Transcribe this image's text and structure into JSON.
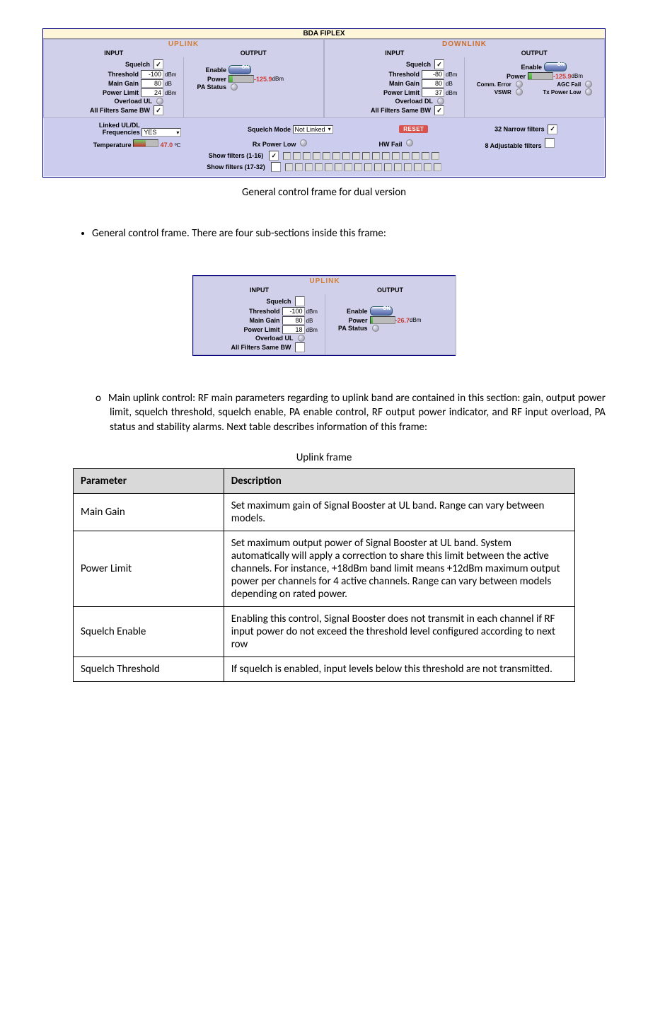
{
  "figTitle": "BDA FIPLEX",
  "uplink": {
    "title": "UPLINK",
    "input": "INPUT",
    "output": "OUTPUT",
    "in": {
      "squelch_l": "Squelch",
      "squelch_chk": "✓",
      "threshold_l": "Threshold",
      "threshold_v": "-100",
      "threshold_u": "dBm",
      "gain_l": "Main Gain",
      "gain_v": "80",
      "gain_u": "dB",
      "plimit_l": "Power Limit",
      "plimit_v": "24",
      "plimit_u": "dBm",
      "overload_l": "Overload UL",
      "allfilt_l": "All Filters Same BW",
      "allfilt_chk": "✓"
    },
    "out": {
      "enable_l": "Enable",
      "enable_v": "ON",
      "power_l": "Power",
      "power_v": "-125.9",
      "power_u": "dBm",
      "pa_l": "PA Status"
    }
  },
  "downlink": {
    "title": "DOWNLINK",
    "input": "INPUT",
    "output": "OUTPUT",
    "in": {
      "squelch_l": "Squelch",
      "squelch_chk": "✓",
      "threshold_l": "Threshold",
      "threshold_v": "-80",
      "threshold_u": "dBm",
      "gain_l": "Main Gain",
      "gain_v": "80",
      "gain_u": "dB",
      "plimit_l": "Power Limit",
      "plimit_v": "37",
      "plimit_u": "dBm",
      "overload_l": "Overload DL",
      "allfilt_l": "All Filters Same BW",
      "allfilt_chk": "✓"
    },
    "out": {
      "enable_l": "Enable",
      "enable_v": "ON",
      "power_l": "Power",
      "power_v": "-125.9",
      "power_u": "dBm",
      "comm_l": "Comm. Error",
      "agc_l": "AGC Fail",
      "vswr_l": "VSWR",
      "txlow_l": "Tx Power Low"
    }
  },
  "bottom": {
    "linked_l": "Linked UL/DL Frequencies",
    "linked_v": "YES",
    "sqmode_l": "Squelch Mode",
    "sqmode_v": "Not Linked",
    "reset": "RESET",
    "narrow_l": "32 Narrow filters",
    "narrow_chk": "✓",
    "temp_l": "Temperature",
    "temp_v": "47.0",
    "temp_u": "ºC",
    "rxlow_l": "Rx Power Low",
    "hwfail_l": "HW Fail",
    "adj_l": "8 Adjustable filters",
    "show1_l": "Show filters (1-16)",
    "show1_chk": "✓",
    "show2_l": "Show filters (17-32)"
  },
  "caption1": "General control frame for dual version",
  "bullet1": "General control frame. There are four sub-sections inside this frame:",
  "fig2": {
    "uplink": {
      "title": "UPLINK",
      "input": "INPUT",
      "output": "OUTPUT",
      "squelch_l": "Squelch",
      "threshold_l": "Threshold",
      "threshold_v": "-100",
      "threshold_u": "dBm",
      "gain_l": "Main Gain",
      "gain_v": "80",
      "gain_u": "dB",
      "plimit_l": "Power Limit",
      "plimit_v": "18",
      "plimit_u": "dBm",
      "overload_l": "Overload UL",
      "allfilt_l": "All Filters Same BW",
      "enable_l": "Enable",
      "enable_v": "ON",
      "power_l": "Power",
      "power_v": "-26.7",
      "power_u": "dBm",
      "pa_l": "PA Status"
    }
  },
  "sub1": "Main uplink control: RF main parameters regarding to uplink band are contained in this section: gain, output power limit, squelch threshold, squelch enable, PA enable control, RF output power indicator, and RF input overload, PA status and stability alarms. Next table describes information of this frame:",
  "tablecap": "Uplink frame",
  "th_param": "Parameter",
  "th_desc": "Description",
  "rows": [
    {
      "p": "Main Gain",
      "d": "Set maximum gain of Signal Booster at UL band. Range can vary between models."
    },
    {
      "p": "Power Limit",
      "d": "Set maximum output power of Signal Booster at UL band. System automatically will apply a correction to share this limit between the active channels. For instance, +18dBm band limit means +12dBm maximum output power per channels for 4 active channels. Range can vary between models depending on rated power."
    },
    {
      "p": "Squelch Enable",
      "d": "Enabling this control, Signal Booster does not transmit in each channel if RF input power do not exceed the threshold level configured according to next row"
    },
    {
      "p": "Squelch Threshold",
      "d": "If squelch is enabled, input levels below this threshold are not transmitted."
    }
  ]
}
